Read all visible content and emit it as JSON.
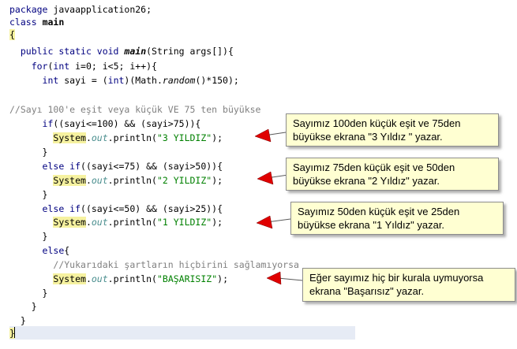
{
  "code": {
    "l1_pkg_kw": "package",
    "l1_pkg_name": " javaapplication26;",
    "l2_class_kw": "class",
    "l2_class_name": "main",
    "l3_brace": "{",
    "l4_mods": "public static void",
    "l4_method": "main",
    "l4_rest": "(String args[]){",
    "l5_for": "for",
    "l5_open": "(",
    "l5_int": "int",
    "l5_rest": " i=0; i<5; i++){",
    "l6_int": "int",
    "l6_a": " sayi = (",
    "l6_int2": "int",
    "l6_b": ")(Math.",
    "l6_random": "random",
    "l6_c": "()*150);",
    "l8_comment": "//Sayı 100'e eşit veya küçük VE 75 ten büyükse",
    "l9_if": "if",
    "l9_rest": "((sayi<=100) && (sayi>75)){",
    "system": "System",
    "dot": ".",
    "out": "out",
    "println": ".println(",
    "close": ");",
    "s3": "\"3 YILDIZ\"",
    "rbrace": "}",
    "l12_else": "else if",
    "l12_rest": "((sayi<=75) && (sayi>50)){",
    "s2": "\"2 YILDIZ\"",
    "l15_else": "else if",
    "l15_rest": "((sayi<=50) && (sayi>25)){",
    "s1": "\"1 YILDIZ\"",
    "l18_else": "else",
    "l18_rest": "{",
    "l19_comment": "//Yukarıdaki şartların hiçbirini sağlamıyorsa",
    "s0": "\"BAŞARISIZ\""
  },
  "callouts": [
    {
      "line1": "Sayımız 100den küçük eşit ve 75den",
      "line2": "büyükse ekrana \"3 Yıldız \" yazar."
    },
    {
      "line1": "Sayımız 75den küçük eşit ve 50den",
      "line2": "büyükse ekrana \"2 Yıldız\" yazar."
    },
    {
      "line1": "Sayımız 50den küçük eşit ve 25den",
      "line2": "büyükse ekrana \"1 Yıldız\" yazar."
    },
    {
      "line1": "Eğer sayımız hiç bir kurala uymuyorsa",
      "line2": "ekrana \"Başarısız\" yazar."
    }
  ],
  "colors": {
    "keyword": "#000080",
    "string": "#008000",
    "comment": "#808080",
    "field": "#4b8f8f",
    "highlight": "#f6f2a0",
    "callout_bg": "#ffffd2",
    "arrow": "#e00000"
  }
}
